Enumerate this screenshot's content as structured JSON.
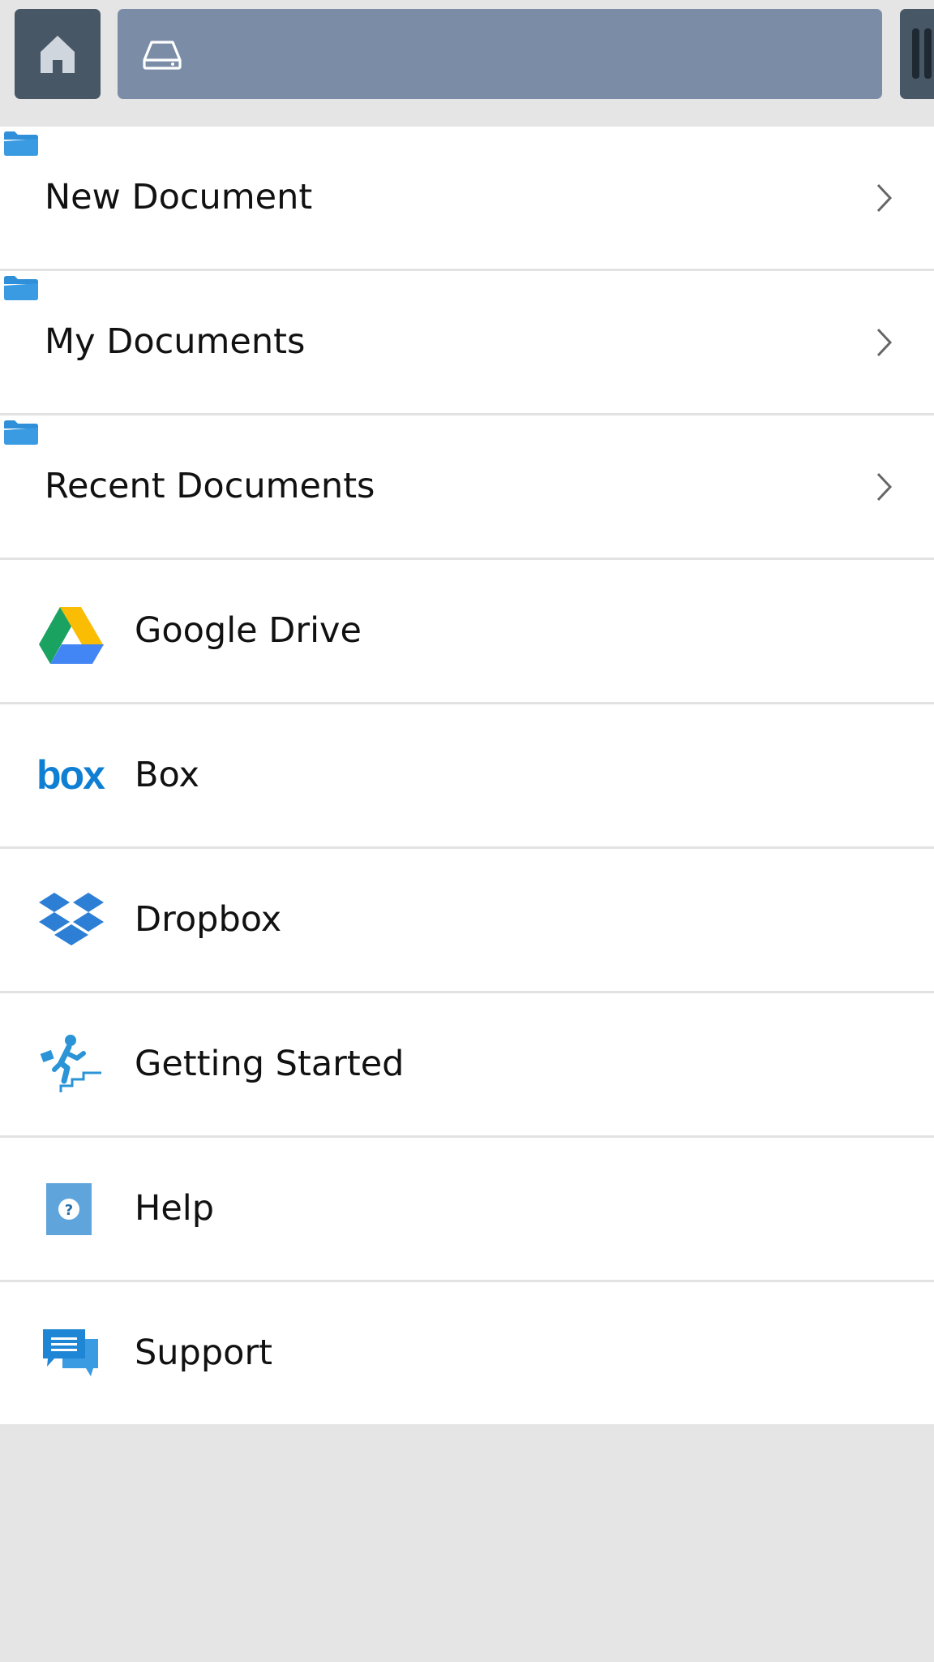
{
  "toolbar": {
    "home_icon": "home-icon",
    "path_icon": "drive-icon",
    "path_text": "",
    "menu_icon": "menu-icon",
    "colors": {
      "home_bg": "#475766",
      "path_bg": "#7b8ca6"
    }
  },
  "folders": [
    {
      "label": "New Document",
      "icon": "folder-icon"
    },
    {
      "label": "My Documents",
      "icon": "folder-icon"
    },
    {
      "label": "Recent Documents",
      "icon": "folder-icon"
    }
  ],
  "services": [
    {
      "label": "Google Drive",
      "icon": "google-drive-icon"
    },
    {
      "label": "Box",
      "icon": "box-icon"
    },
    {
      "label": "Dropbox",
      "icon": "dropbox-icon"
    },
    {
      "label": "Getting Started",
      "icon": "getting-started-icon"
    },
    {
      "label": "Help",
      "icon": "help-icon"
    },
    {
      "label": "Support",
      "icon": "support-icon"
    }
  ],
  "colors": {
    "accent": "#2f8fd8",
    "background": "#e5e5e5",
    "list_bg": "#ffffff",
    "divider": "#e2e2e2"
  }
}
